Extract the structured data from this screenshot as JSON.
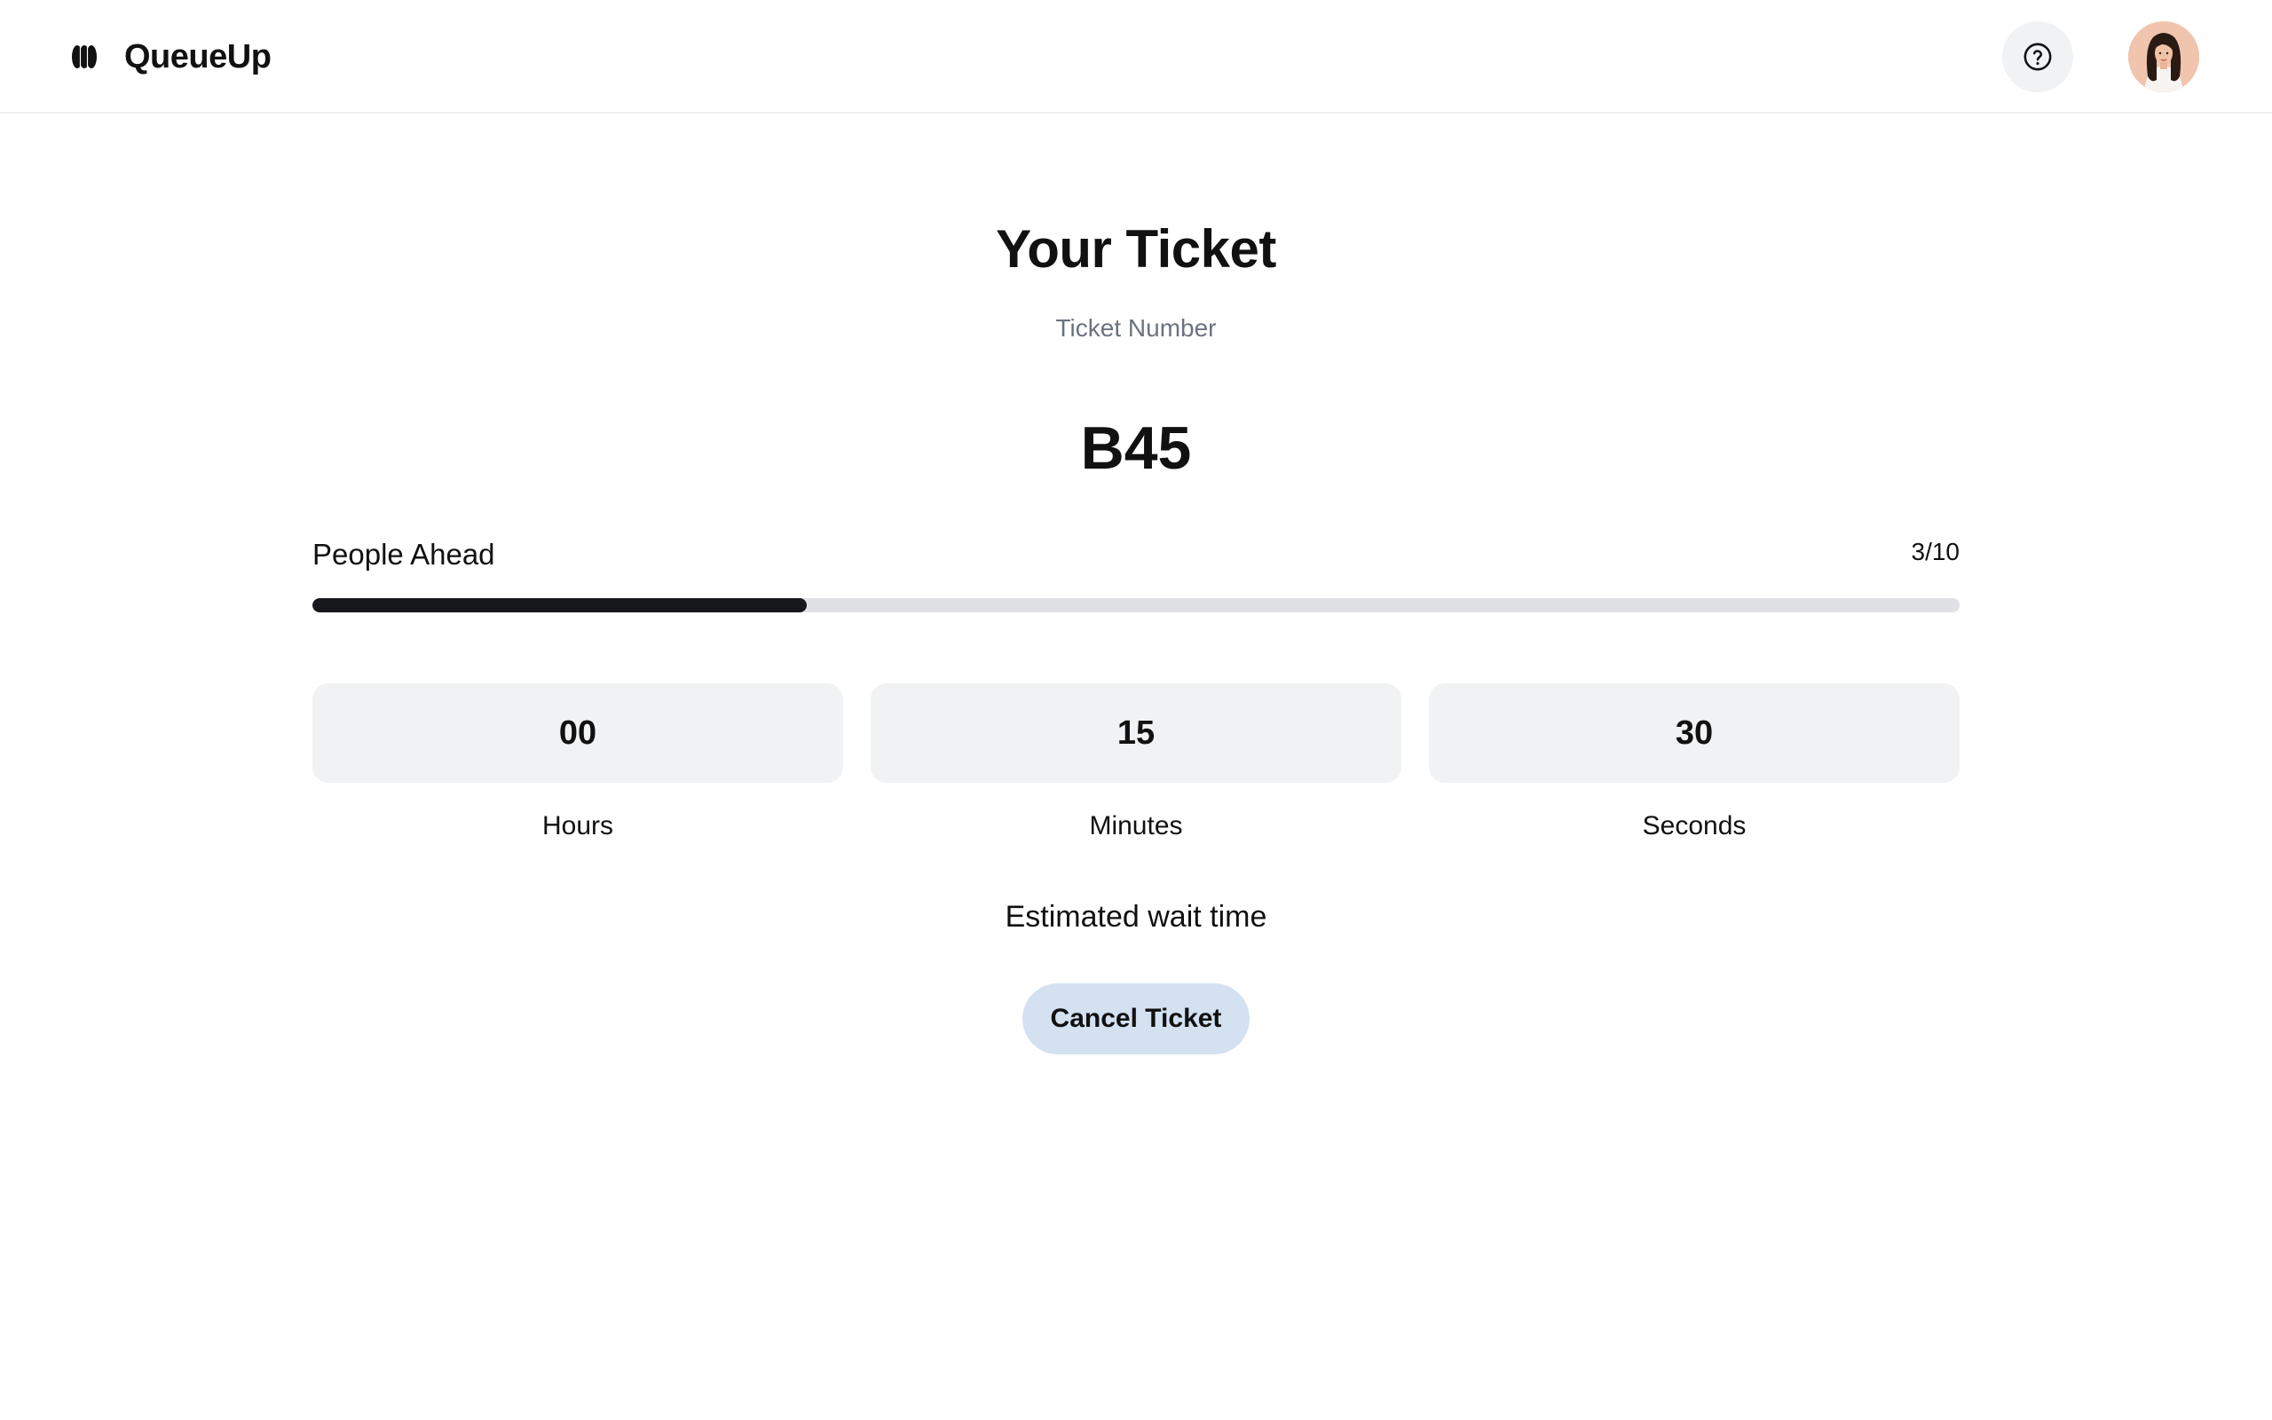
{
  "app": {
    "name": "QueueUp",
    "logo_icon": "queueup-logo-icon"
  },
  "header": {
    "help_icon": "question-circle-icon",
    "avatar_icon": "user-avatar"
  },
  "ticket": {
    "title": "Your Ticket",
    "number_label": "Ticket Number",
    "number": "B45"
  },
  "queue": {
    "people_ahead_label": "People Ahead",
    "people_ahead_count": "3/10",
    "progress_fraction": 0.3
  },
  "wait_time": {
    "hours": {
      "value": "00",
      "label": "Hours"
    },
    "minutes": {
      "value": "15",
      "label": "Minutes"
    },
    "seconds": {
      "value": "30",
      "label": "Seconds"
    },
    "caption": "Estimated wait time"
  },
  "actions": {
    "cancel_label": "Cancel Ticket"
  },
  "colors": {
    "progress_fill": "#17181b",
    "progress_track": "#dfe1e4",
    "cancel_button_bg": "#d3e1f0",
    "time_box_bg": "#f1f2f3"
  }
}
